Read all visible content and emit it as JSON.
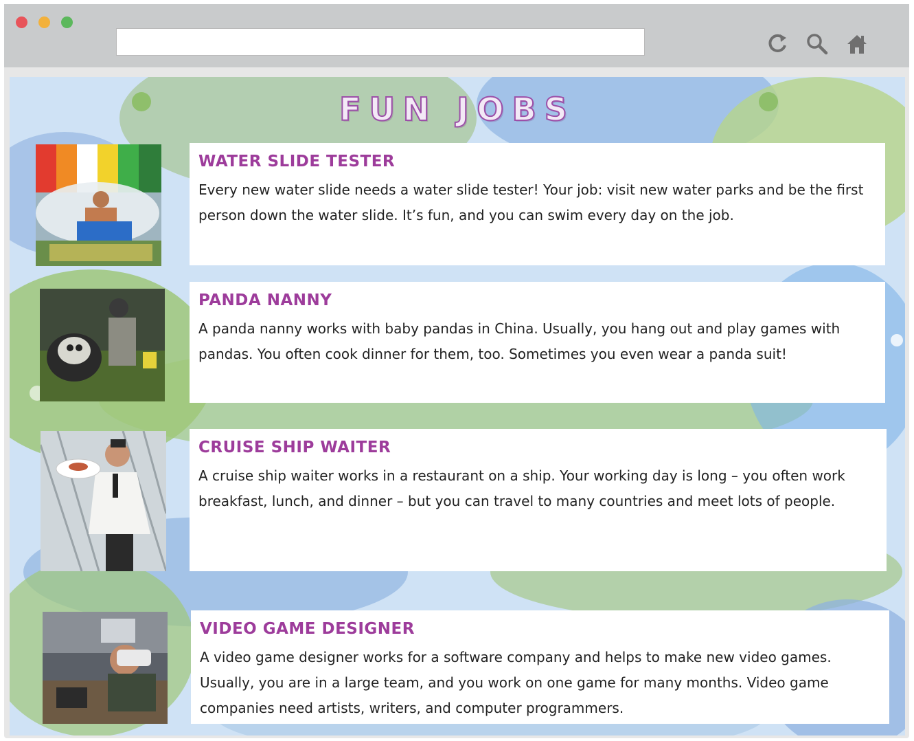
{
  "browser": {
    "address_value": "",
    "icons": [
      "reload-icon",
      "search-icon",
      "home-icon"
    ],
    "window_controls": [
      "close",
      "minimize",
      "maximize"
    ]
  },
  "page": {
    "title": "FUN  JOBS"
  },
  "jobs": [
    {
      "title": "WATER SLIDE TESTER",
      "description": "Every new water slide needs a water slide tester! Your job: visit new water parks and be the first person down the water slide. It’s fun, and you can swim every day on the job.",
      "photo": "man on a water slide"
    },
    {
      "title": "PANDA NANNY",
      "description": "A panda nanny works with baby pandas in China. Usually, you hang out and play games with pandas. You often cook dinner for them, too. Sometimes you even wear a panda suit!",
      "photo": "panda nanny with a panda"
    },
    {
      "title": "CRUISE SHIP WAITER",
      "description": "A cruise ship waiter works in a restaurant on a ship. Your working day is long – you often work breakfast, lunch, and dinner – but you can travel to many countries and meet lots of people.",
      "photo": "waiter carrying a plate"
    },
    {
      "title": "VIDEO GAME DESIGNER",
      "description": "A video game designer works for a software company and helps to make new video games. Usually, you are in a large team, and you work on one game for many months. Video game companies need artists, writers, and computer programmers.",
      "photo": "designer wearing a VR headset"
    }
  ],
  "colors": {
    "title_purple": "#9d3c9b",
    "background_blue": "#cfe2f5",
    "background_green": "#9fc77a"
  }
}
